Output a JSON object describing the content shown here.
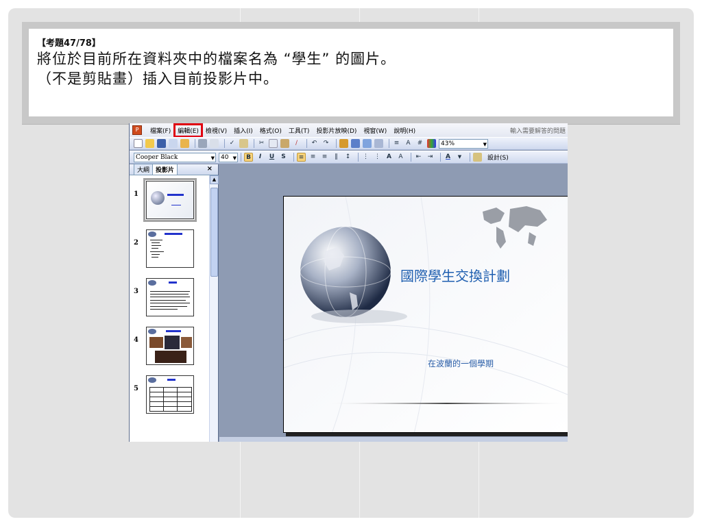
{
  "question": {
    "number": "【考題47/78】",
    "line1": "將位於目前所在資料夾中的檔案名為 “學生” 的圖片。",
    "line2": "（不是剪貼畫）插入目前投影片中。"
  },
  "menubar": {
    "items": [
      "檔案(F)",
      "編輯(E)",
      "檢視(V)",
      "插入(I)",
      "格式(O)",
      "工具(T)",
      "投影片放映(D)",
      "視窗(W)",
      "說明(H)"
    ],
    "highlighted": "編輯(E)",
    "help_placeholder": "輸入需要解答的問題"
  },
  "toolbar": {
    "zoom": "43%",
    "font_name": "Cooper Black",
    "font_size": "40",
    "design_label": "設計(S)"
  },
  "pane": {
    "tab_outline": "大綱",
    "tab_slides": "投影片",
    "close": "×",
    "slide_numbers": [
      "1",
      "2",
      "3",
      "4",
      "5"
    ]
  },
  "slide": {
    "title": "國際學生交換計劃",
    "subtitle": "在波蘭的一個學期"
  },
  "colors": {
    "highlight_box": "#e00010",
    "slide_title": "#1f5fb0"
  }
}
